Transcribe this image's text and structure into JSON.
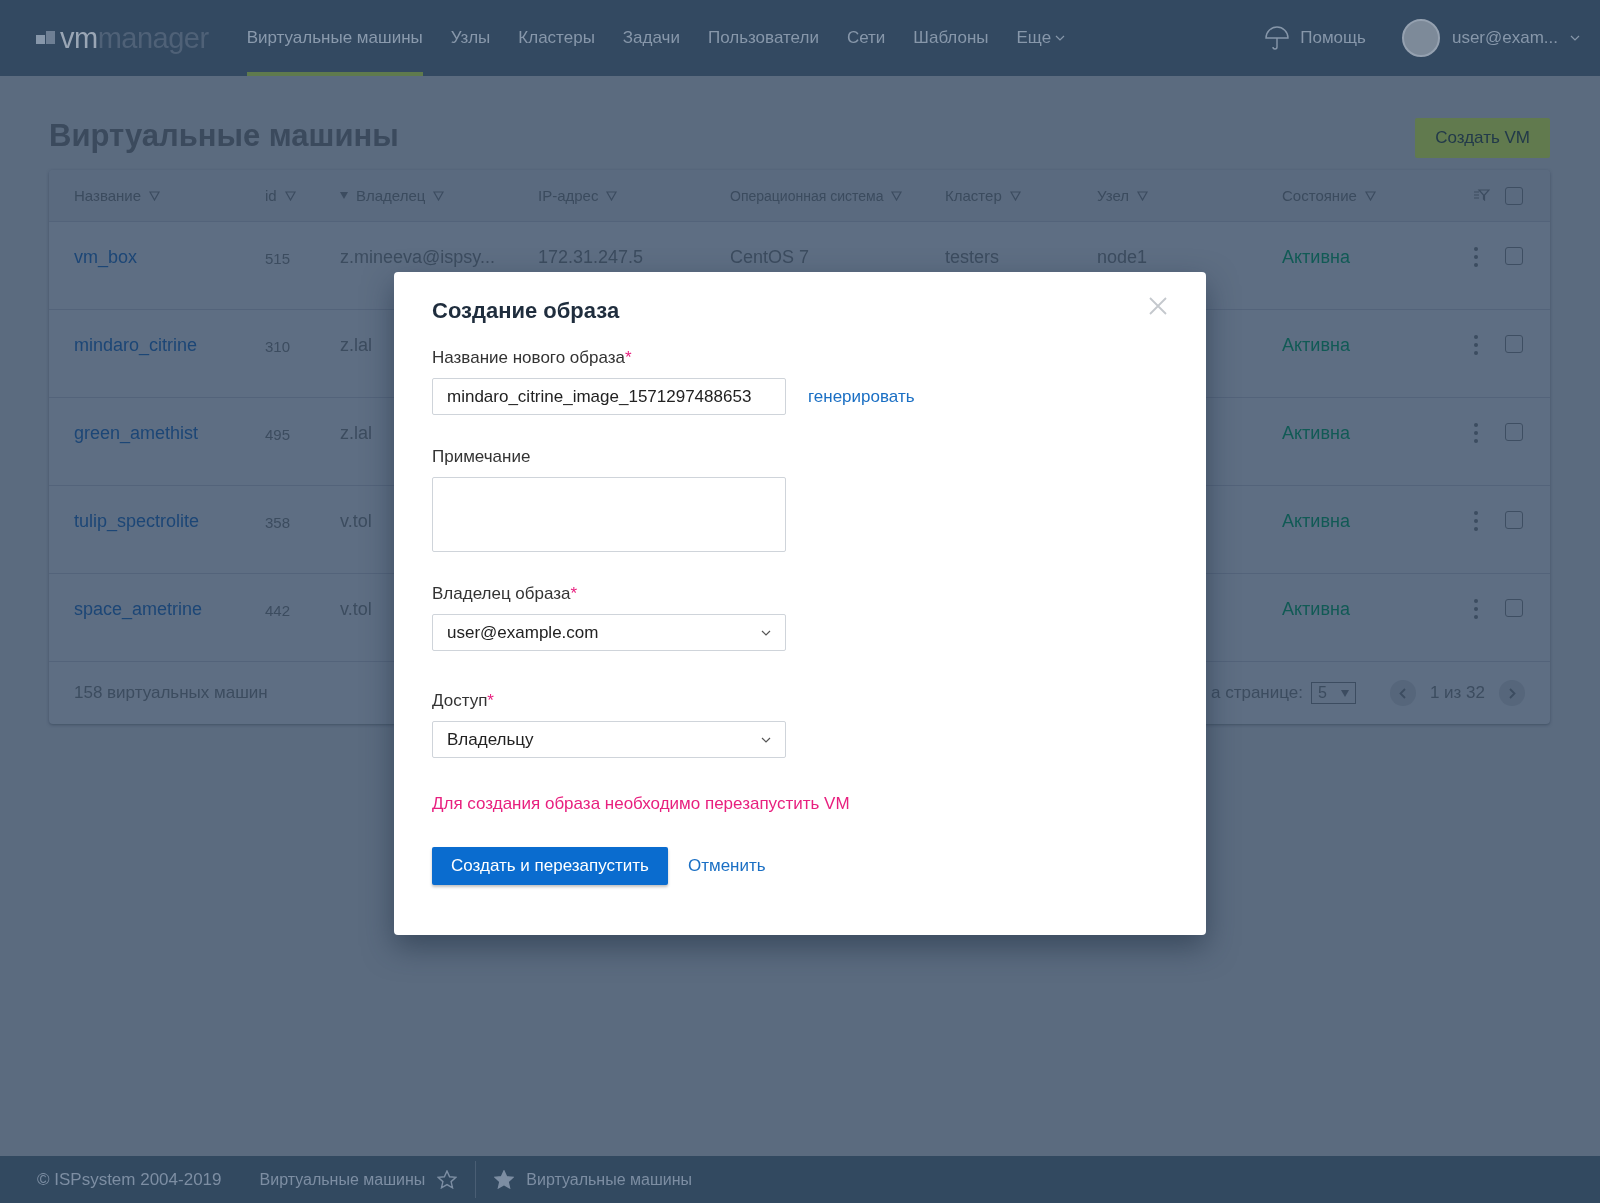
{
  "nav": {
    "logo": {
      "part_1": "vm",
      "part_2": "manager"
    },
    "items": [
      {
        "label": "Виртуальные машины",
        "selected": true
      },
      {
        "label": "Узлы",
        "selected": false
      },
      {
        "label": "Кластеры",
        "selected": false
      },
      {
        "label": "Задачи",
        "selected": false
      },
      {
        "label": "Пользователи",
        "selected": false
      },
      {
        "label": "Сети",
        "selected": false
      },
      {
        "label": "Шаблоны",
        "selected": false
      }
    ],
    "more": "Еще",
    "help": "Помощь",
    "user": "user@exam..."
  },
  "page": {
    "title": "Виртуальные машины",
    "create_button": "Создать VM"
  },
  "table": {
    "columns": [
      {
        "label": "Название",
        "sorted": false
      },
      {
        "label": "id",
        "sorted": false
      },
      {
        "label": "Владелец",
        "sorted": true
      },
      {
        "label": "IP-адрес",
        "sorted": false
      },
      {
        "label": "Операционная система",
        "sorted": false
      },
      {
        "label": "Кластер",
        "sorted": false
      },
      {
        "label": "Узел",
        "sorted": false
      },
      {
        "label": "Состояние",
        "sorted": false
      }
    ],
    "all_checked": false,
    "rows": [
      {
        "name": "vm_box",
        "id": "515",
        "owner": "z.mineeva@ispsy...",
        "ip": "172.31.247.5",
        "os": "CentOS 7",
        "cluster": "testers",
        "node": "node1",
        "status": "Активна",
        "checked": false
      },
      {
        "name": "mindaro_citrine",
        "id": "310",
        "owner": "z.lal",
        "status": "Активна",
        "checked": false
      },
      {
        "name": "green_amethist",
        "id": "495",
        "owner": "z.lal",
        "status": "Активна",
        "checked": false
      },
      {
        "name": "tulip_spectrolite",
        "id": "358",
        "owner": "v.tol",
        "status": "Активна",
        "checked": false
      },
      {
        "name": "space_ametrine",
        "id": "442",
        "owner": "v.tol",
        "status": "Активна",
        "checked": false
      }
    ],
    "count": "158 виртуальных машин",
    "per_page_label": "а странице:",
    "per_page": "5",
    "pages": "1 из 32"
  },
  "dialog": {
    "title": "Создание образа",
    "fields": [
      {
        "kind": "text",
        "label": "Название нового образа",
        "required_mark": "*",
        "value": "mindaro_citrine_image_1571297488653",
        "action": "генерировать"
      },
      {
        "kind": "textarea",
        "label": "Примечание"
      },
      {
        "kind": "select",
        "label": "Владелец образа",
        "required_mark": "*",
        "value": "user@example.com"
      },
      {
        "kind": "select",
        "label": "Доступ",
        "required_mark": "*",
        "value": "Владельцу"
      }
    ],
    "warning": "Для создания образа необходимо перезапустить VM",
    "submit": "Создать и перезапустить",
    "cancel": "Отменить"
  },
  "footer": {
    "copyright": "© ISPsystem 2004-2019",
    "current_page": {
      "label": "Виртуальные машины",
      "starred": false
    },
    "bookmarks": [
      {
        "label": "Виртуальные машины"
      }
    ]
  }
}
